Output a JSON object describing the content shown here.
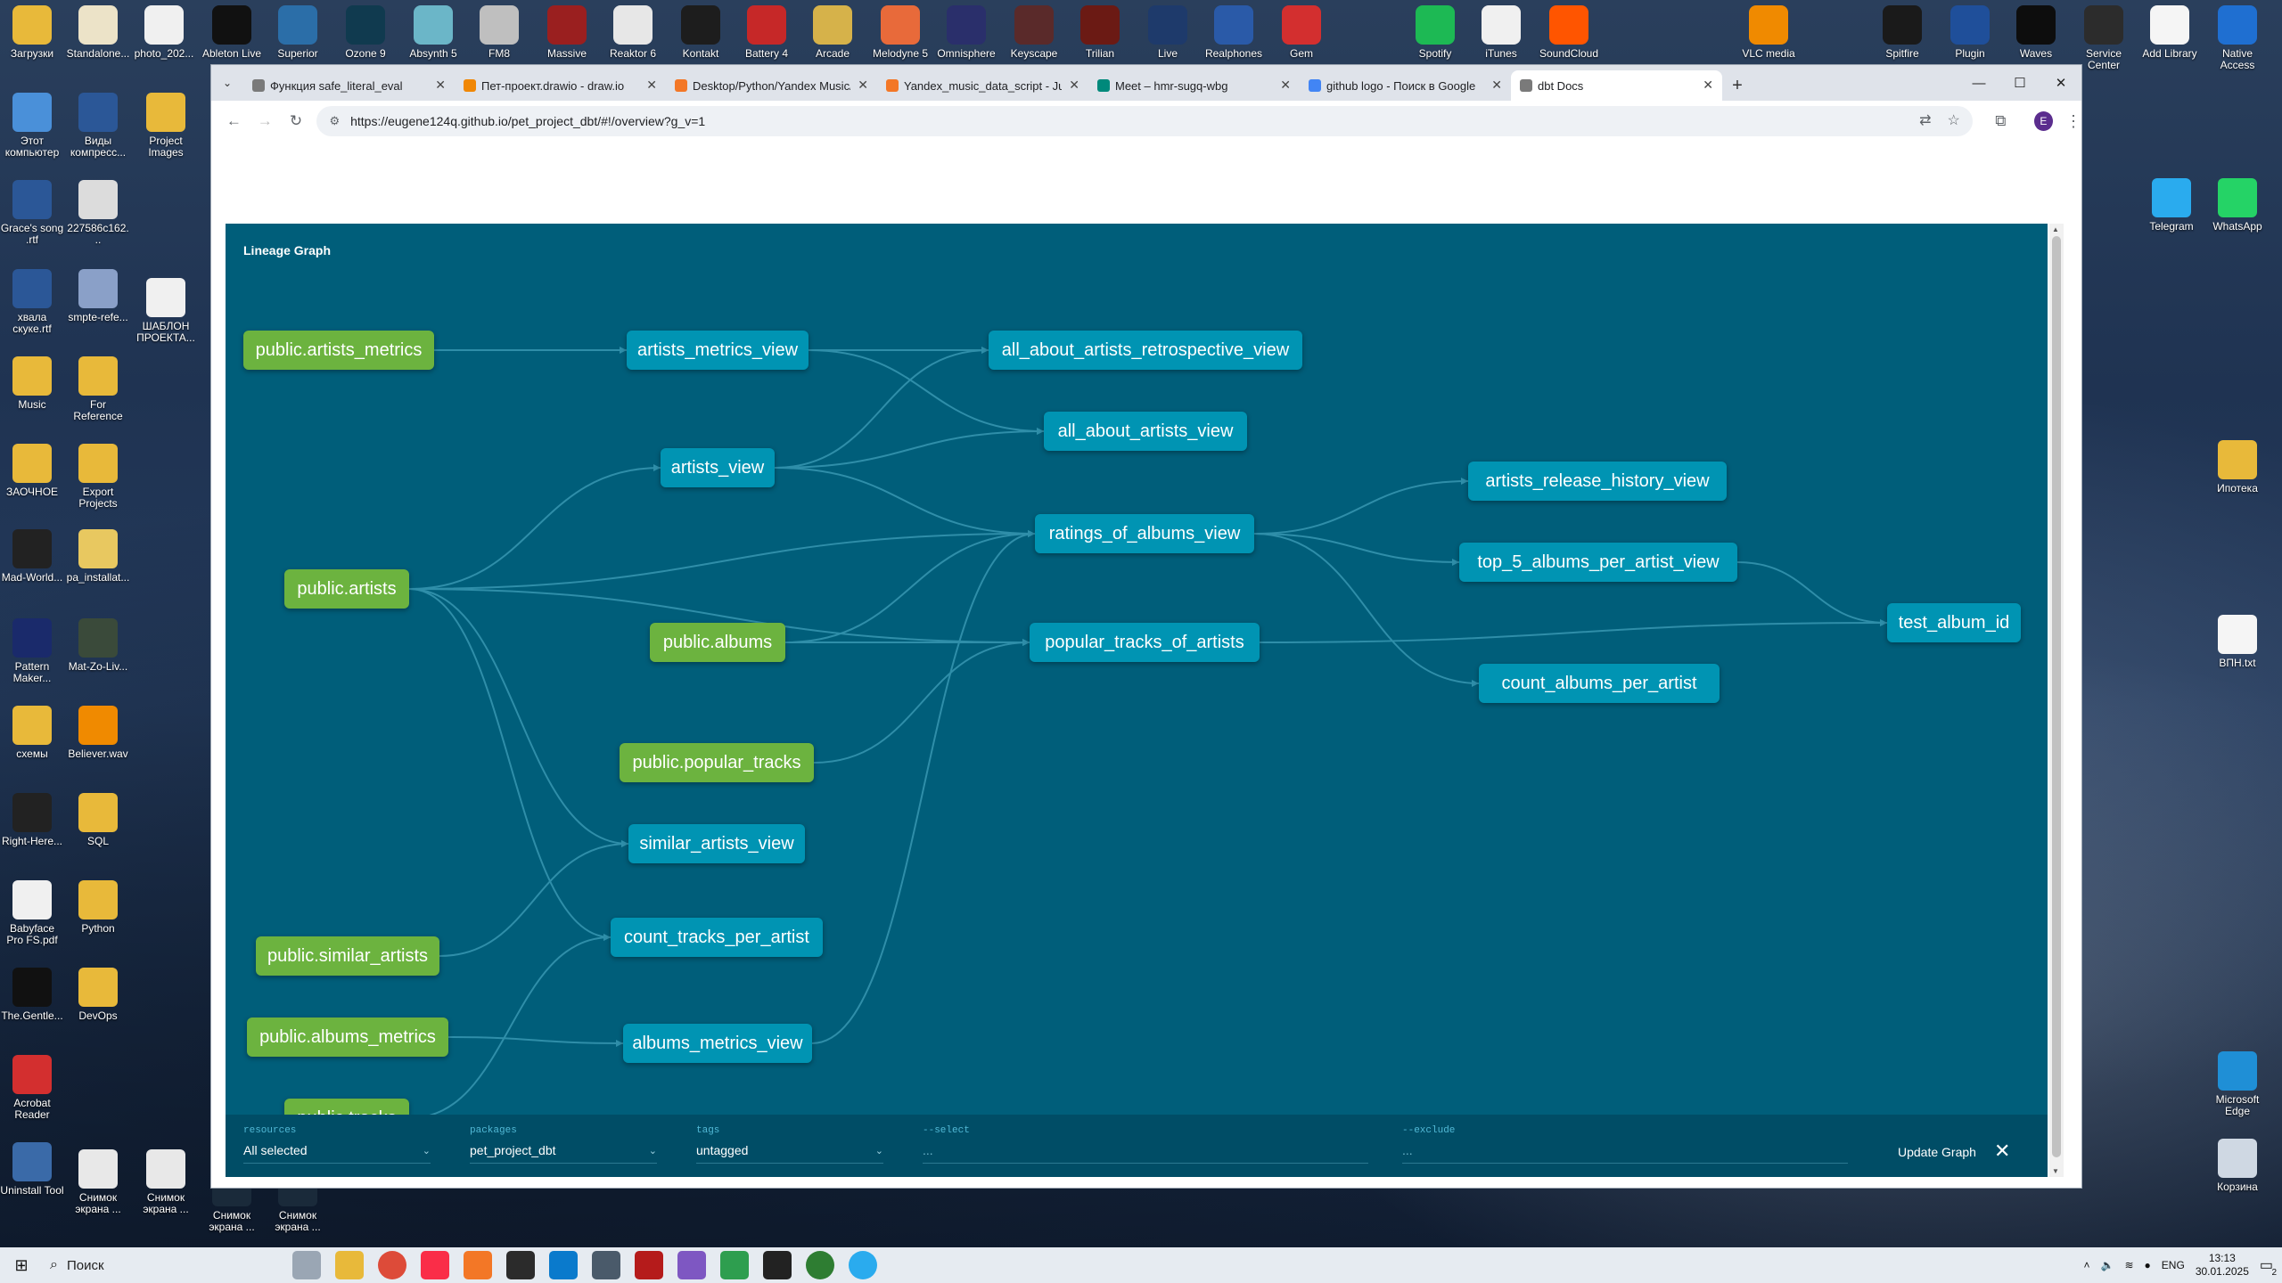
{
  "desktop": {
    "top_icons": [
      {
        "label": "Загрузки",
        "color": "#e8b93a"
      },
      {
        "label": "Standalone...",
        "color": "#ece3c8"
      },
      {
        "label": "photo_202...",
        "color": "#f0f0f0"
      },
      {
        "label": "Ableton Live",
        "color": "#111111"
      },
      {
        "label": "Superior",
        "color": "#2b6ea8"
      },
      {
        "label": "Ozone 9",
        "color": "#103a4f"
      },
      {
        "label": "Absynth 5",
        "color": "#6bb6c8"
      },
      {
        "label": "FM8",
        "color": "#bfbfbf"
      },
      {
        "label": "Massive",
        "color": "#9a1f1f"
      },
      {
        "label": "Reaktor 6",
        "color": "#e7e7e7"
      },
      {
        "label": "Kontakt",
        "color": "#1d1d1d"
      },
      {
        "label": "Battery 4",
        "color": "#c62828"
      },
      {
        "label": "Arcade",
        "color": "#d6b24a"
      },
      {
        "label": "Melodyne 5",
        "color": "#e86a3a"
      },
      {
        "label": "Omnisphere",
        "color": "#2a2f6b"
      },
      {
        "label": "Keyscape",
        "color": "#5a2a2a"
      },
      {
        "label": "Trilian",
        "color": "#6b1a14"
      },
      {
        "label": "Live",
        "color": "#1e3a6b"
      },
      {
        "label": "Realphones",
        "color": "#2a5aa8"
      },
      {
        "label": "Gem",
        "color": "#d32f2f"
      },
      {
        "label": "Spotify",
        "color": "#1db954"
      },
      {
        "label": "iTunes",
        "color": "#f0f0f0"
      },
      {
        "label": "SoundCloud",
        "color": "#ff5500"
      },
      {
        "label": "VLC media",
        "color": "#f08a00"
      },
      {
        "label": "Spitfire",
        "color": "#1a1a1a"
      },
      {
        "label": "Plugin",
        "color": "#1f4f9a"
      },
      {
        "label": "Waves",
        "color": "#0d0d0d"
      },
      {
        "label": "Service Center",
        "color": "#2c2c2c"
      },
      {
        "label": "Add Library",
        "color": "#f5f5f5"
      },
      {
        "label": "Native Access",
        "color": "#1f6fd1"
      }
    ],
    "left_icons": [
      {
        "label": "Этот компьютер",
        "color": "#4a90d9"
      },
      {
        "label": "Виды компресс...",
        "color": "#2b5797"
      },
      {
        "label": "Project Images",
        "color": "#e8b93a"
      },
      {
        "label": "Grace's song .rtf",
        "color": "#2b5797"
      },
      {
        "label": "227586c162...",
        "color": "#dcdcdc"
      },
      {
        "label": "хвала скуке.rtf",
        "color": "#2b5797"
      },
      {
        "label": "smpte-refe...",
        "color": "#8aa0c8"
      },
      {
        "label": "ШАБЛОН ПРОЕКТА...",
        "color": "#f0f0f0"
      },
      {
        "label": "Music",
        "color": "#e8b93a"
      },
      {
        "label": "For Reference",
        "color": "#e8b93a"
      },
      {
        "label": "ЗАОЧНОЕ",
        "color": "#e8b93a"
      },
      {
        "label": "Export Projects",
        "color": "#e8b93a"
      },
      {
        "label": "Mad-World...",
        "color": "#222222"
      },
      {
        "label": "pa_installat...",
        "color": "#e8c860"
      },
      {
        "label": "Pattern Maker...",
        "color": "#1a2a6b"
      },
      {
        "label": "Mat-Zo-Liv...",
        "color": "#3a4a3a"
      },
      {
        "label": "схемы",
        "color": "#e8b93a"
      },
      {
        "label": "Believer.wav",
        "color": "#f08a00"
      },
      {
        "label": "Right-Here...",
        "color": "#222222"
      },
      {
        "label": "SQL",
        "color": "#e8b93a"
      },
      {
        "label": "Babyface Pro FS.pdf",
        "color": "#f0f0f0"
      },
      {
        "label": "Python",
        "color": "#e8b93a"
      },
      {
        "label": "The.Gentle...",
        "color": "#111111"
      },
      {
        "label": "DevOps",
        "color": "#e8b93a"
      },
      {
        "label": "Acrobat Reader",
        "color": "#d32f2f"
      },
      {
        "label": "Uninstall Tool",
        "color": "#3a6aa8"
      },
      {
        "label": "Снимок экрана ...",
        "color": "#e8e8e8"
      },
      {
        "label": "Снимок экрана ...",
        "color": "#e8e8e8"
      },
      {
        "label": "Снимок экрана ...",
        "color": "#1a2a3a"
      },
      {
        "label": "Снимок экрана ...",
        "color": "#1a2a3a"
      }
    ],
    "right_icons": [
      {
        "label": "Telegram",
        "color": "#2aabee"
      },
      {
        "label": "WhatsApp",
        "color": "#25d366"
      },
      {
        "label": "Ипотека",
        "color": "#e8b93a"
      },
      {
        "label": "ВПН.txt",
        "color": "#f5f5f5"
      },
      {
        "label": "Microsoft Edge",
        "color": "#1f8fd6"
      },
      {
        "label": "Корзина",
        "color": "#cfd8e3"
      }
    ]
  },
  "browser": {
    "tabs": [
      {
        "title": "Функция safe_literal_eval",
        "color": "#7a7a7a"
      },
      {
        "title": "Пет-проект.drawio - draw.io",
        "color": "#f08705"
      },
      {
        "title": "Desktop/Python/Yandex Music/",
        "color": "#f37726"
      },
      {
        "title": "Yandex_music_data_script - Jup",
        "color": "#f37726"
      },
      {
        "title": "Meet – hmr-sugq-wbg",
        "color": "#00897b"
      },
      {
        "title": "github logo - Поиск в Google",
        "color": "#4285f4"
      },
      {
        "title": "dbt Docs",
        "color": "#7a7a7a"
      }
    ],
    "url": "https://eugene124q.github.io/pet_project_dbt/#!/overview?g_v=1",
    "profile_initial": "E"
  },
  "graph": {
    "title": "Lineage Graph",
    "nodes": {
      "artists_metrics_src": "public.artists_metrics",
      "artists_src": "public.artists",
      "similar_artists_src": "public.similar_artists",
      "albums_metrics_src": "public.albums_metrics",
      "tracks_src": "public.tracks",
      "artists_metrics_view": "artists_metrics_view",
      "artists_view": "artists_view",
      "albums_src": "public.albums",
      "popular_tracks_src": "public.popular_tracks",
      "similar_artists_view": "similar_artists_view",
      "count_tracks_per_artist": "count_tracks_per_artist",
      "albums_metrics_view": "albums_metrics_view",
      "all_about_artists_retrospective_view": "all_about_artists_retrospective_view",
      "all_about_artists_view": "all_about_artists_view",
      "ratings_of_albums_view": "ratings_of_albums_view",
      "popular_tracks_of_artists": "popular_tracks_of_artists",
      "artists_release_history_view": "artists_release_history_view",
      "top_5_albums_per_artist_view": "top_5_albums_per_artist_view",
      "count_albums_per_artist": "count_albums_per_artist",
      "test_album_id": "test_album_id"
    },
    "filters": {
      "resources_label": "resources",
      "resources_value": "All selected",
      "packages_label": "packages",
      "packages_value": "pet_project_dbt",
      "tags_label": "tags",
      "tags_value": "untagged",
      "select_label": "--select",
      "select_value": "...",
      "exclude_label": "--exclude",
      "exclude_value": "...",
      "update_label": "Update Graph"
    }
  },
  "taskbar": {
    "search_label": "Поиск",
    "lang": "ENG",
    "time": "13:13",
    "date": "30.01.2025",
    "notifications": "2"
  }
}
